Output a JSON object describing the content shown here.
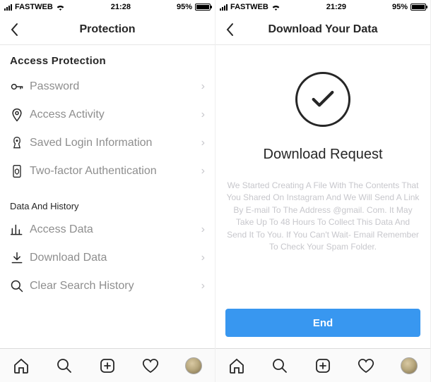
{
  "left": {
    "status": {
      "carrier": "FASTWEB",
      "time": "21:28",
      "battery": "95%"
    },
    "title": "Protection",
    "sections": {
      "access_header": "Access Protection",
      "items_access": [
        {
          "label": "Password"
        },
        {
          "label": "Access Activity"
        },
        {
          "label": "Saved Login Information"
        },
        {
          "label": "Two-factor Authentication"
        }
      ],
      "history_header": "Data And History",
      "items_history": [
        {
          "label": "Access Data"
        },
        {
          "label": "Download Data"
        },
        {
          "label": "Clear Search History"
        }
      ]
    }
  },
  "right": {
    "status": {
      "carrier": "FASTWEB",
      "time": "21:29",
      "battery": "95%"
    },
    "title": "Download Your Data",
    "confirm": {
      "heading": "Download Request",
      "body": "We Started Creating A File With The Contents That You Shared On Instagram And We Will Send A Link By E-mail To The Address @gmail. Com. It May Take Up To 48 Hours To Collect This Data And Send It To You. If You Can't Wait- Email Remember To Check Your Spam Folder.",
      "button": "End"
    }
  }
}
